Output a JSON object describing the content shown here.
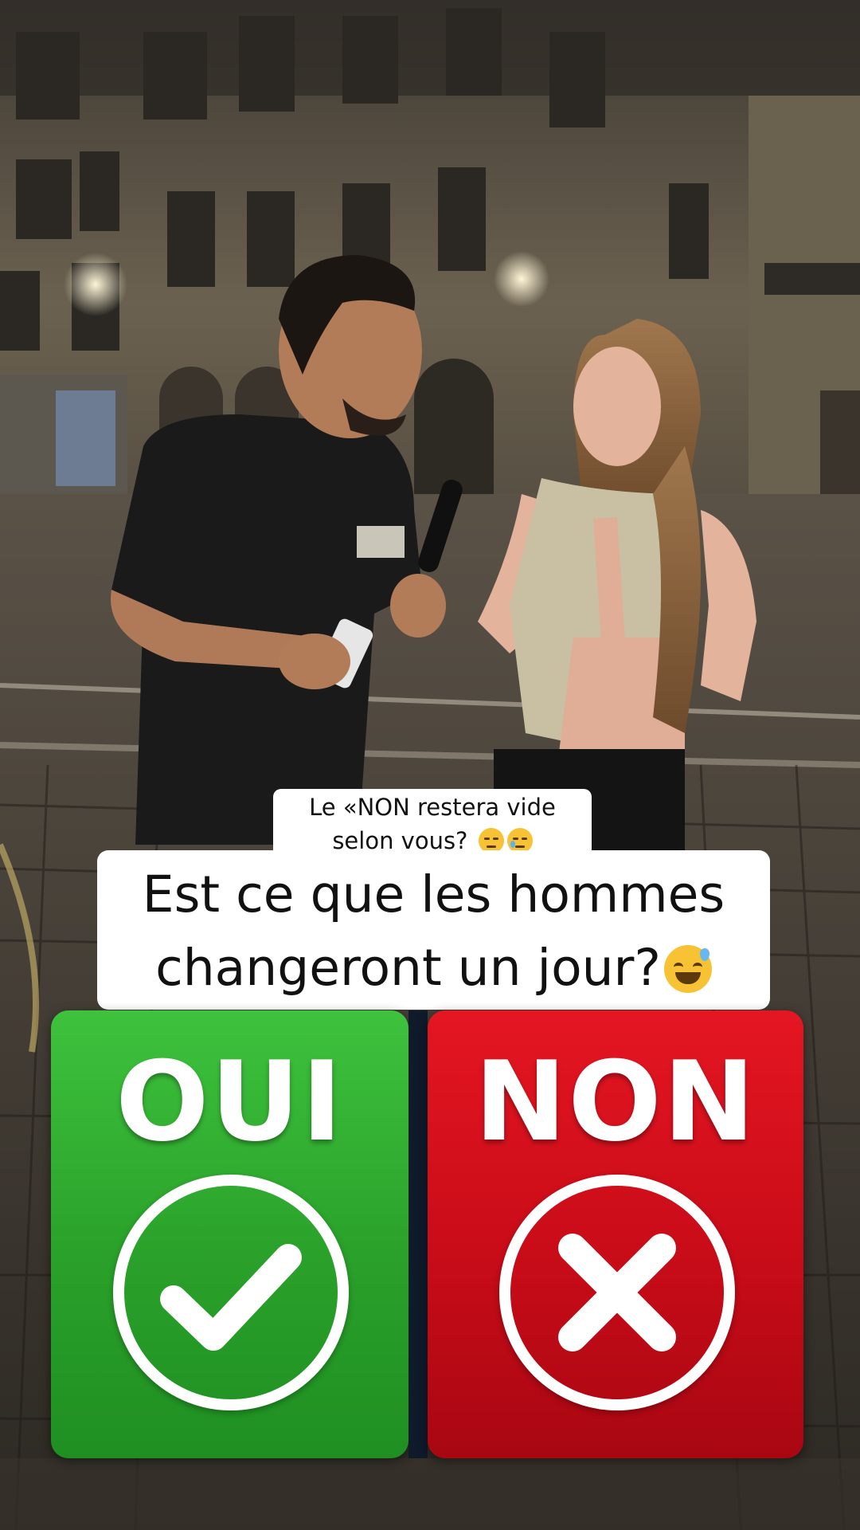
{
  "caption_small": {
    "line1": "Le «NON restera vide",
    "line2": "selon vous?"
  },
  "caption_main": {
    "line1": "Est ce que les hommes",
    "line2": "changeront un jour?"
  },
  "emojis": {
    "small": [
      "pensive-face-icon",
      "crying-face-icon"
    ],
    "main": "grinning-sweat-face-icon"
  },
  "choices": {
    "yes": {
      "label": "OUI",
      "icon": "check-icon",
      "color": "#2ba82c"
    },
    "no": {
      "label": "NON",
      "icon": "x-icon",
      "color": "#d10f1b"
    }
  }
}
